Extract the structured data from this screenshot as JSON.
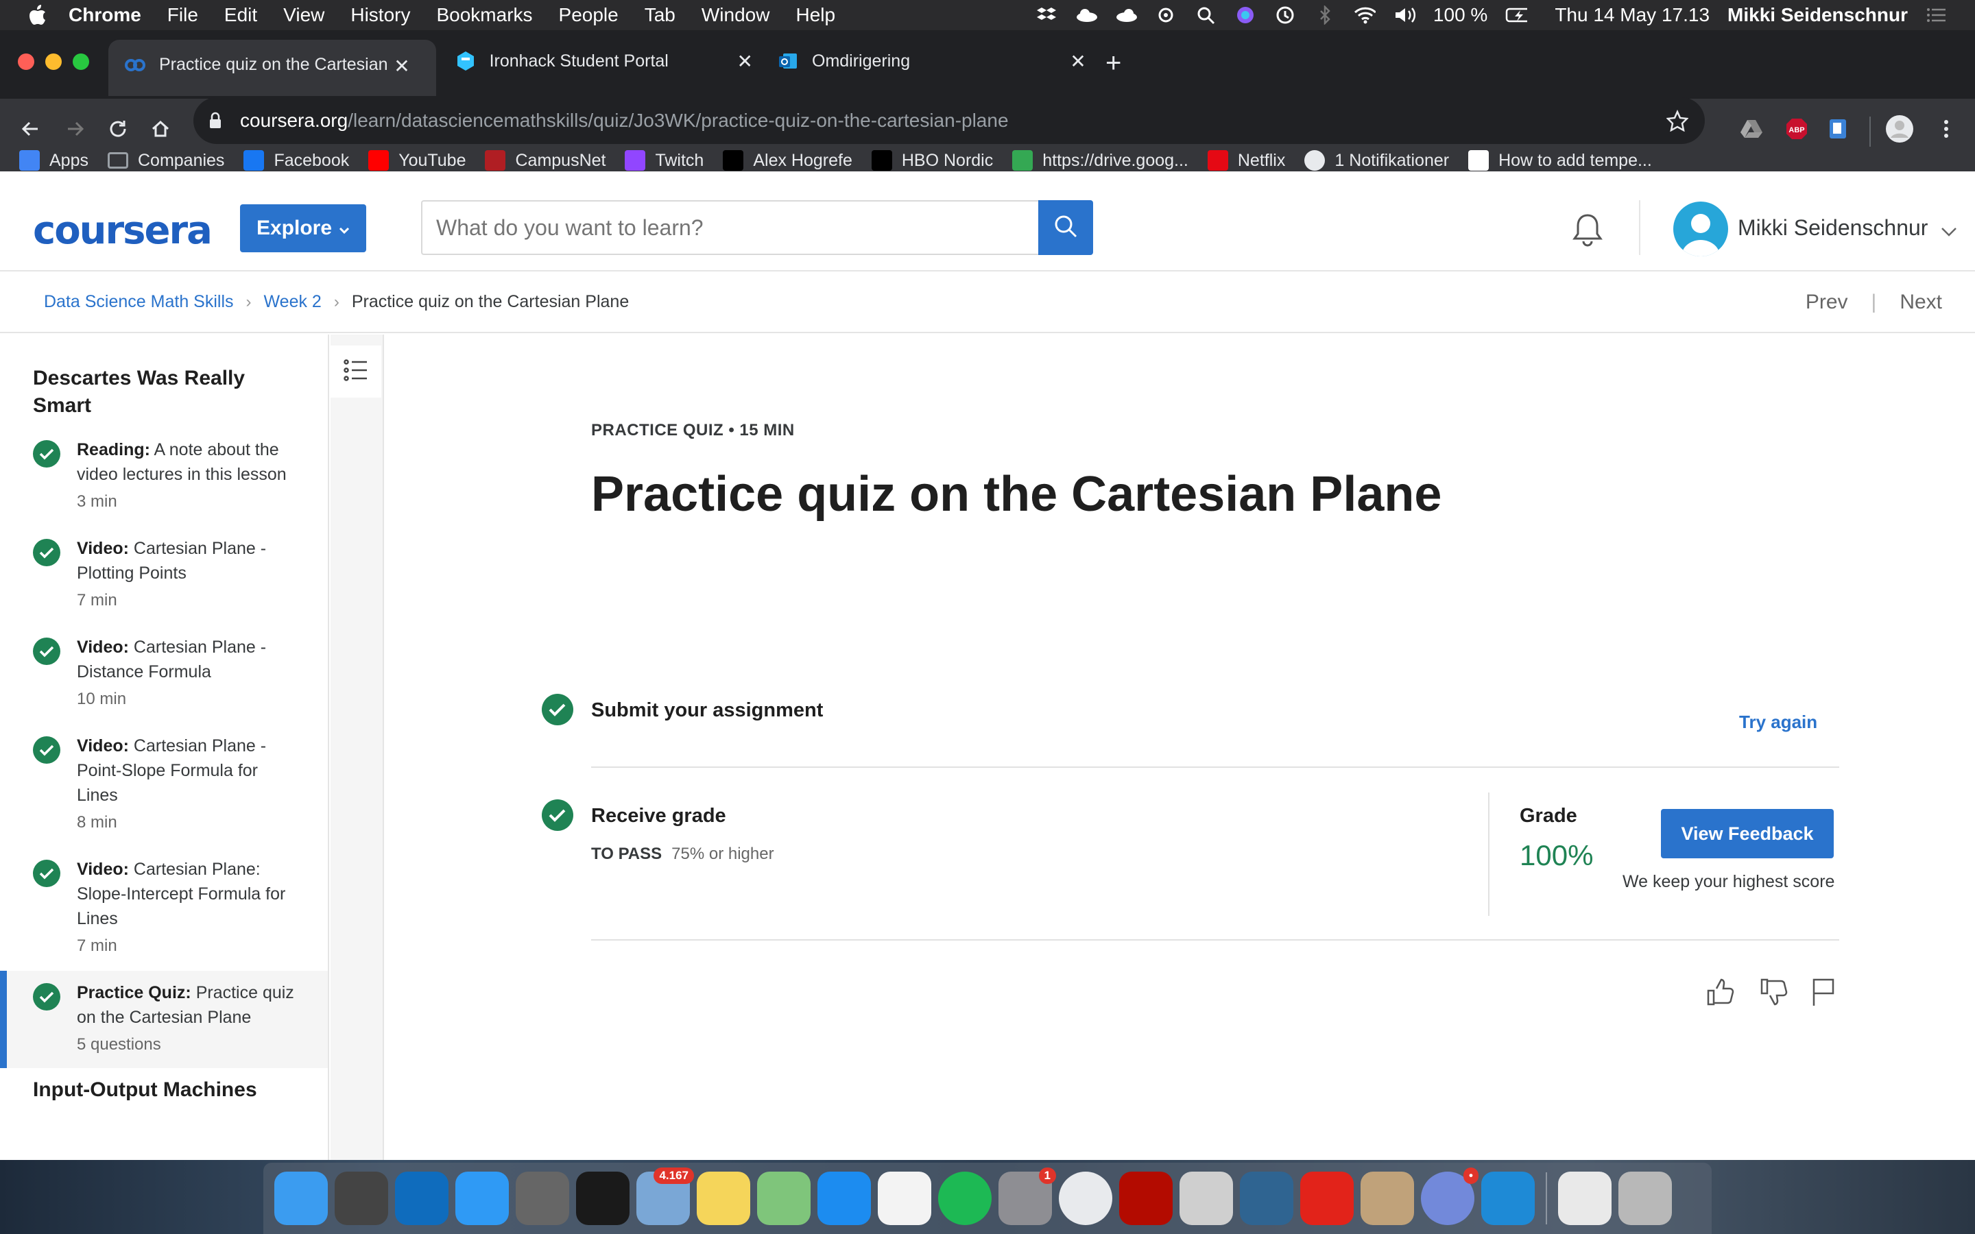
{
  "menubar": {
    "app": "Chrome",
    "items": [
      "File",
      "Edit",
      "View",
      "History",
      "Bookmarks",
      "People",
      "Tab",
      "Window",
      "Help"
    ],
    "battery": "100 %",
    "datetime": "Thu 14 May  17.13",
    "user": "Mikki Seidenschnur"
  },
  "tabs": [
    {
      "title": "Practice quiz on the Cartesian Plane",
      "icon": "coursera-icon",
      "active": true
    },
    {
      "title": "Ironhack Student Portal",
      "icon": "ironhack-icon",
      "active": false
    },
    {
      "title": "Omdirigering",
      "icon": "outlook-icon",
      "active": false
    }
  ],
  "url": {
    "host": "coursera.org",
    "path": "/learn/datasciencemathskills/quiz/Jo3WK/practice-quiz-on-the-cartesian-plane"
  },
  "bookmarks": [
    {
      "label": "Apps",
      "icon": "apps-icon",
      "color": "#4285f4"
    },
    {
      "label": "Companies",
      "icon": "folder-icon",
      "color": "#9aa0a6"
    },
    {
      "label": "Facebook",
      "icon": "facebook-icon",
      "color": "#1877f2"
    },
    {
      "label": "YouTube",
      "icon": "youtube-icon",
      "color": "#ff0000"
    },
    {
      "label": "CampusNet",
      "icon": "campusnet-icon",
      "color": "#b01e23"
    },
    {
      "label": "Twitch",
      "icon": "twitch-icon",
      "color": "#9146ff"
    },
    {
      "label": "Alex Hogrefe",
      "icon": "va-icon",
      "color": "#000000"
    },
    {
      "label": "HBO Nordic",
      "icon": "hbo-icon",
      "color": "#000000"
    },
    {
      "label": "https://drive.goog...",
      "icon": "drive-icon",
      "color": "#34a853"
    },
    {
      "label": "Netflix",
      "icon": "netflix-icon",
      "color": "#e50914"
    },
    {
      "label": "1 Notifikationer",
      "icon": "globe-icon",
      "color": "#e8eaed"
    },
    {
      "label": "How to add tempe...",
      "icon": "wikipedia-icon",
      "color": "#ffffff"
    }
  ],
  "header": {
    "logo": "coursera",
    "explore": "Explore",
    "search_placeholder": "What do you want to learn?",
    "username": "Mikki Seidenschnur"
  },
  "breadcrumb": {
    "course": "Data Science Math Skills",
    "week": "Week 2",
    "current": "Practice quiz on the Cartesian Plane",
    "prev": "Prev",
    "next": "Next"
  },
  "sidebar": {
    "section": "Descartes Was Really Smart",
    "items": [
      {
        "type": "Reading:",
        "title": "A note about the video lectures in this lesson",
        "duration": "3 min"
      },
      {
        "type": "Video:",
        "title": "Cartesian Plane - Plotting Points",
        "duration": "7 min"
      },
      {
        "type": "Video:",
        "title": "Cartesian Plane - Distance Formula",
        "duration": "10 min"
      },
      {
        "type": "Video:",
        "title": "Cartesian Plane - Point-Slope Formula for Lines",
        "duration": "8 min"
      },
      {
        "type": "Video:",
        "title": "Cartesian Plane: Slope-Intercept Formula for Lines",
        "duration": "7 min"
      },
      {
        "type": "Practice Quiz:",
        "title": "Practice quiz on the Cartesian Plane",
        "duration": "5 questions"
      }
    ],
    "next_section": "Input-Output Machines"
  },
  "main": {
    "meta": "PRACTICE QUIZ • 15 MIN",
    "title": "Practice quiz on the Cartesian Plane",
    "submit_title": "Submit your assignment",
    "try_again": "Try again",
    "receive_title": "Receive grade",
    "to_pass_label": "TO PASS",
    "to_pass_value": "75% or higher",
    "grade_label": "Grade",
    "grade_value": "100%",
    "feedback_button": "View Feedback",
    "keep_note": "We keep your highest score"
  },
  "dock": [
    {
      "name": "finder-icon",
      "color": "#3b9cf0"
    },
    {
      "name": "ironhack-app-icon",
      "color": "#444"
    },
    {
      "name": "onedrive-icon",
      "color": "#0f6cbd"
    },
    {
      "name": "messages-icon",
      "color": "#2f9af5"
    },
    {
      "name": "launchpad-icon",
      "color": "#666"
    },
    {
      "name": "activity-monitor-icon",
      "color": "#1a1a1a"
    },
    {
      "name": "mail-icon",
      "color": "#7aa7d6",
      "badge": "4.167"
    },
    {
      "name": "notes-icon",
      "color": "#f5d55a"
    },
    {
      "name": "maps-icon",
      "color": "#7fc57b"
    },
    {
      "name": "app-store-icon",
      "color": "#1c8cf0"
    },
    {
      "name": "photos-icon",
      "color": "#f3f3f3"
    },
    {
      "name": "spotify-icon",
      "color": "#1db954"
    },
    {
      "name": "system-preferences-icon",
      "color": "#8e8e93",
      "badge": "1"
    },
    {
      "name": "chrome-icon",
      "color": "#e8eaed"
    },
    {
      "name": "acrobat-icon",
      "color": "#b30b00"
    },
    {
      "name": "sequel-icon",
      "color": "#cfcfcf"
    },
    {
      "name": "mysql-workbench-icon",
      "color": "#2f6491"
    },
    {
      "name": "acrobat-reader-icon",
      "color": "#e2231a"
    },
    {
      "name": "calculator-icon",
      "color": "#c0a27a"
    },
    {
      "name": "discord-icon",
      "color": "#7289da",
      "badge": "•"
    },
    {
      "name": "vscode-icon",
      "color": "#1e8ad6"
    },
    {
      "name": "documents-folder-icon",
      "color": "#e9e9e9"
    },
    {
      "name": "trash-icon",
      "color": "#b8b8b8"
    }
  ]
}
